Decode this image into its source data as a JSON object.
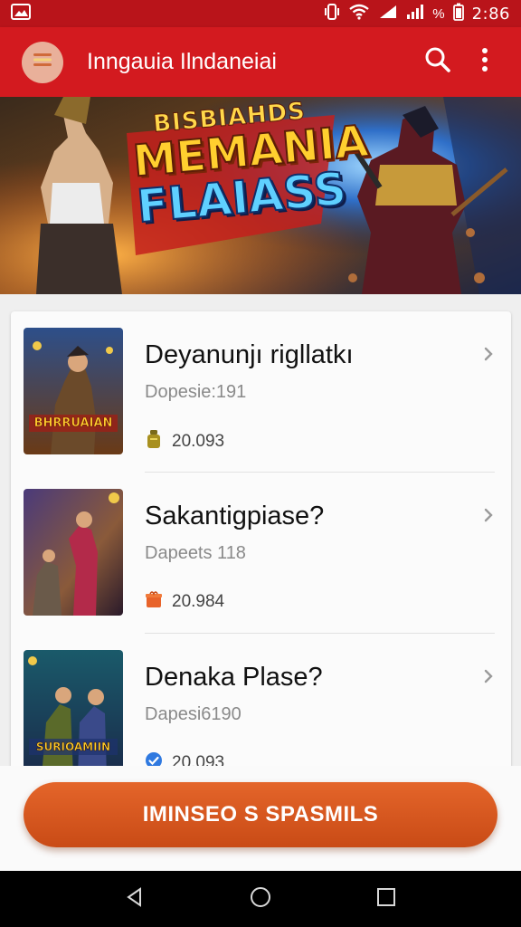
{
  "status_bar": {
    "time": "2:86",
    "battery_percent": "%",
    "icons": [
      "image-icon",
      "vibrate-icon",
      "wifi-icon",
      "signal-icon",
      "battery-icon"
    ]
  },
  "app_bar": {
    "title": "Inngauia Ilndaneiai",
    "icons": [
      "menu-icon",
      "search-icon",
      "more-vert-icon"
    ]
  },
  "banner": {
    "line1": "BISBIAHDS",
    "line2": "MEMANIA",
    "line3": "FLAIASS"
  },
  "games": [
    {
      "title": "Deyanunjı rigllatkı",
      "subtitle": "Dopesie:191",
      "count": "20.093",
      "meta_icon": "coin-bag-icon",
      "thumb_label": "BHRRUAIAN"
    },
    {
      "title": "Sakantigpiase?",
      "subtitle": "Dapeets 118",
      "count": "20.984",
      "meta_icon": "gift-box-icon"
    },
    {
      "title": "Denaka Plase?",
      "subtitle": "Dapesi6190",
      "count": "20.093",
      "meta_icon": "verified-check-icon",
      "thumb_label": "SURIOAMIIN"
    }
  ],
  "cta": {
    "label": "IMINSEO S SPASMILS"
  },
  "colors": {
    "status_bar": "#b9141a",
    "app_bar": "#d31a1f",
    "cta": "#d9561f"
  },
  "nav_bar": {
    "icons": [
      "back-icon",
      "home-icon",
      "recents-icon"
    ]
  }
}
